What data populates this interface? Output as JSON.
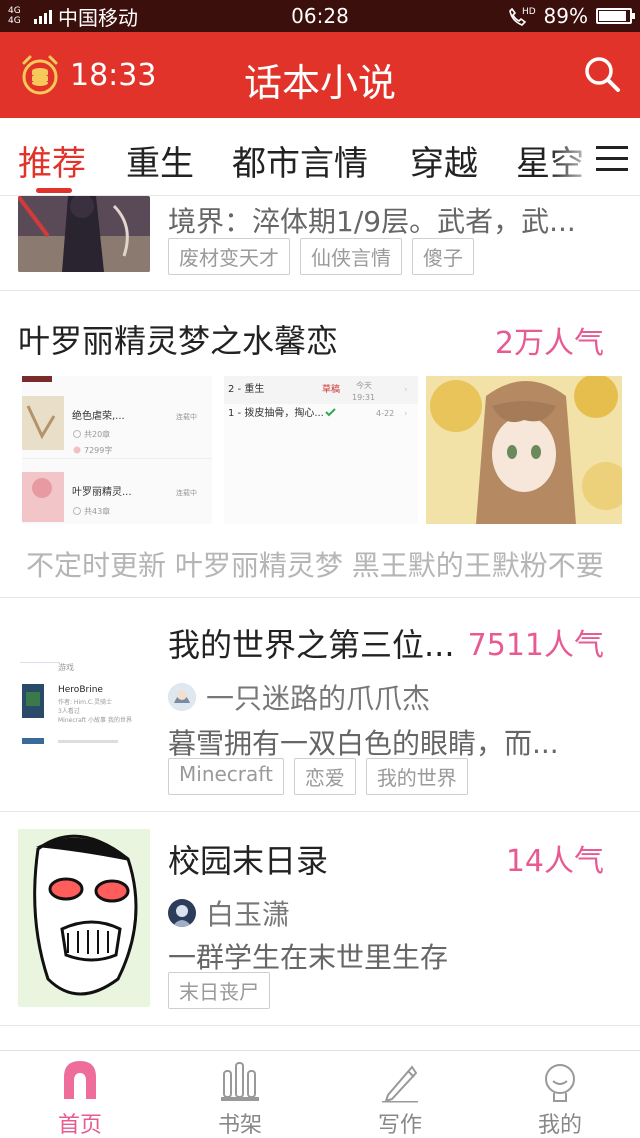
{
  "status_bar": {
    "network": "4G 4G",
    "carrier": "中国移动",
    "time": "06:28",
    "call_badge": "HD",
    "battery": "89%",
    "battery_level": 0.89
  },
  "header": {
    "time": "18:33",
    "title": "话本小说",
    "accent_color": "#e2332a"
  },
  "tabs": [
    {
      "label": "推荐",
      "active": true
    },
    {
      "label": "重生",
      "active": false
    },
    {
      "label": "都市言情",
      "active": false
    },
    {
      "label": "穿越",
      "active": false
    },
    {
      "label": "星空",
      "active": false
    }
  ],
  "list": {
    "partial_item": {
      "desc": "境界：淬体期1/9层。武者，武...",
      "tags": [
        "废材变天才",
        "仙侠言情",
        "傻子"
      ]
    },
    "featured": {
      "title": "叶罗丽精灵梦之水馨恋",
      "popularity": "2万人气",
      "shot1": {
        "row1": {
          "title": "绝色虐荣,...",
          "status": "连载中",
          "chapters": "共20章",
          "words": "7299字"
        },
        "row2": {
          "title": "叶罗丽精灵...",
          "status": "连载中",
          "chapters": "共43章"
        }
      },
      "shot2": {
        "row1": {
          "label": "2 - 重生",
          "tag": "草稿",
          "date1": "今天",
          "date2": "19:31"
        },
        "row2": {
          "label": "1 - 拨皮抽骨，掏心...",
          "date": "4-22"
        }
      },
      "subline": "不定时更新 叶罗丽精灵梦 黑王默的王默粉不要"
    },
    "items": [
      {
        "title": "我的世界之第三位...",
        "popularity": "7511人气",
        "author": "一只迷路的爪爪杰",
        "desc": "暮雪拥有一双白色的眼睛，而...",
        "tags": [
          "Minecraft",
          "恋爱",
          "我的世界"
        ],
        "cover_text": {
          "header": "游戏",
          "name": "HeroBrine",
          "line1": "作者: Him.C.灵骑士",
          "line2": "3人看过",
          "line3": "Minecraft 小故事 我的世界"
        }
      },
      {
        "title": "校园末日录",
        "popularity": "14人气",
        "author": "白玉潇",
        "desc": "一群学生在末世里生存",
        "tags": [
          "末日丧尸"
        ]
      }
    ]
  },
  "bottom_nav": [
    {
      "label": "首页",
      "icon": "home-icon",
      "active": true
    },
    {
      "label": "书架",
      "icon": "bookshelf-icon",
      "active": false
    },
    {
      "label": "写作",
      "icon": "pen-icon",
      "active": false
    },
    {
      "label": "我的",
      "icon": "profile-icon",
      "active": false
    }
  ],
  "colors": {
    "brand_red": "#e2332a",
    "popularity_pink": "#e85a92",
    "status_bar": "#3a0f0c"
  }
}
